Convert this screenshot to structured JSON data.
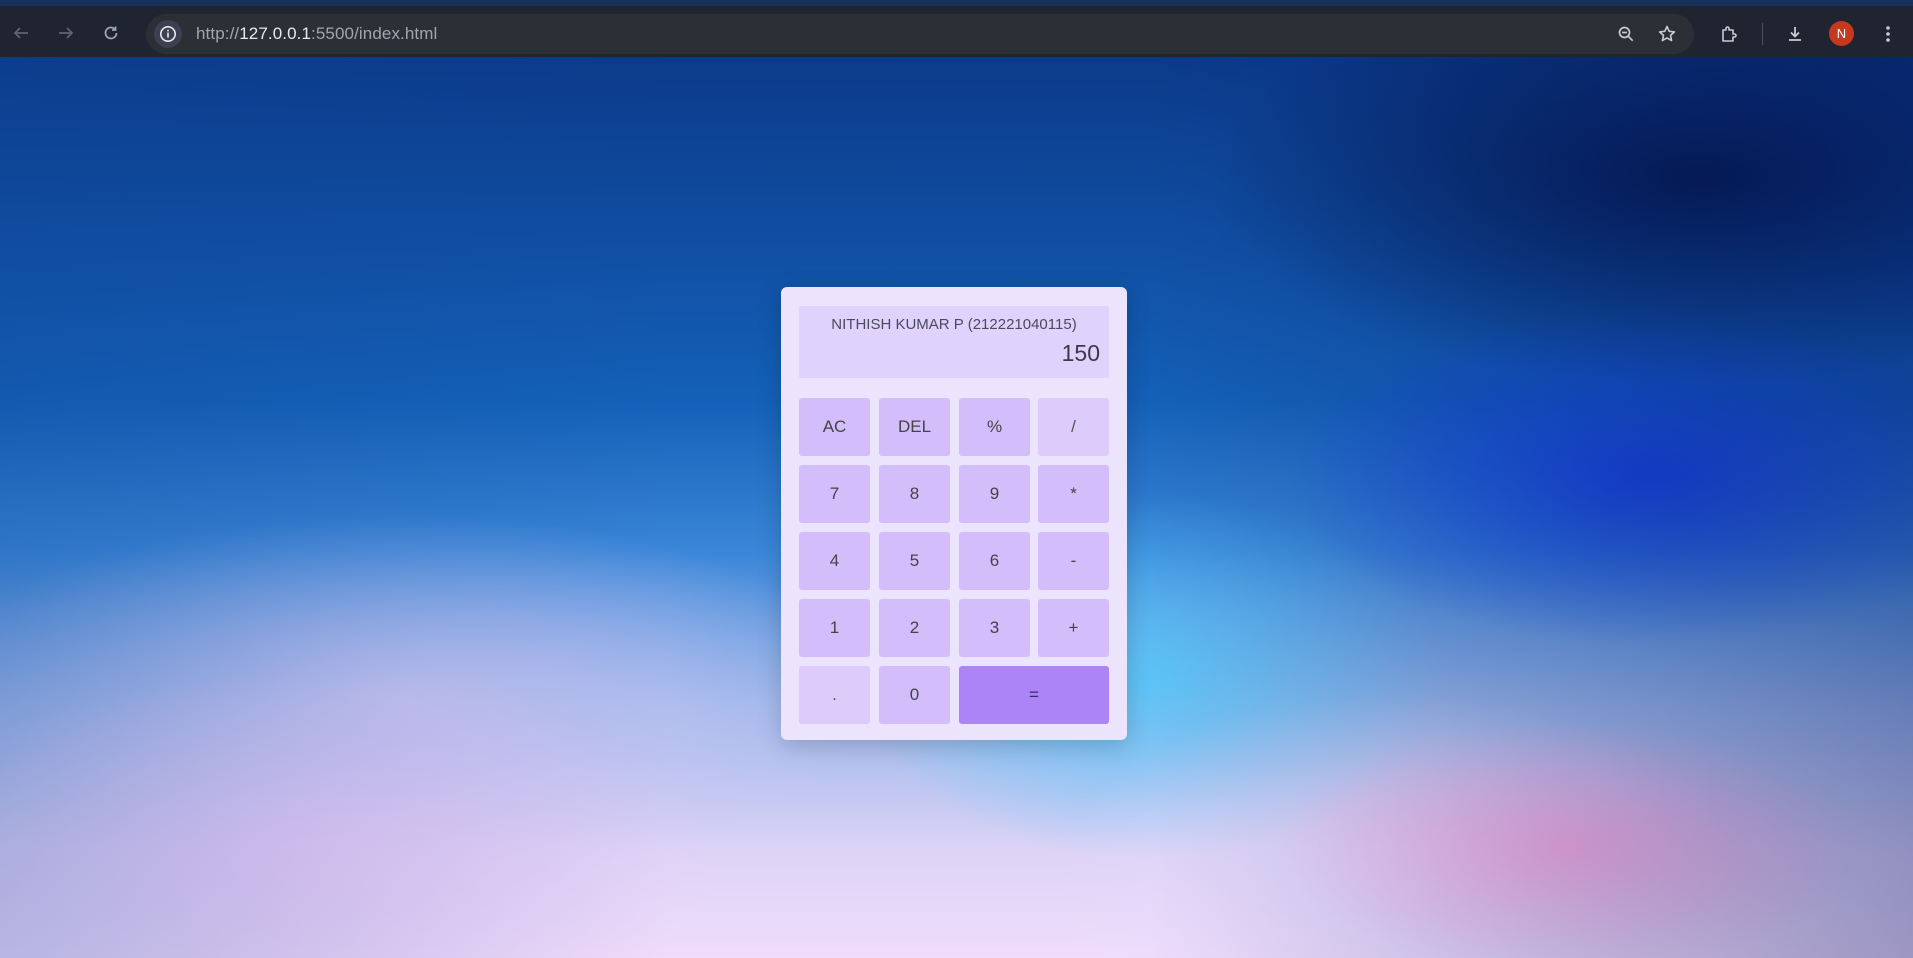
{
  "browser": {
    "url_prefix": "http://",
    "url_host": "127.0.0.1",
    "url_rest": ":5500/index.html",
    "avatar_letter": "N",
    "icons": [
      "back-arrow-icon",
      "forward-arrow-icon",
      "reload-icon",
      "info-icon",
      "zoom-icon",
      "star-icon",
      "extensions-icon",
      "download-icon",
      "kebab-menu-icon"
    ]
  },
  "calculator": {
    "name_label": "NITHISH KUMAR P (212221040115)",
    "display_value": "150",
    "keys": {
      "ac": "AC",
      "del": "DEL",
      "percent": "%",
      "divide": "/",
      "seven": "7",
      "eight": "8",
      "nine": "9",
      "multiply": "*",
      "four": "4",
      "five": "5",
      "six": "6",
      "minus": "-",
      "one": "1",
      "two": "2",
      "three": "3",
      "plus": "+",
      "dot": ".",
      "zero": "0",
      "equals": "="
    }
  },
  "colors": {
    "calc_panel": "#ece3fc",
    "display_bg": "#dfd2fc",
    "key_bg": "#d3bdfa",
    "equals_bg": "#ac84f8",
    "avatar_bg": "#c7391e"
  }
}
